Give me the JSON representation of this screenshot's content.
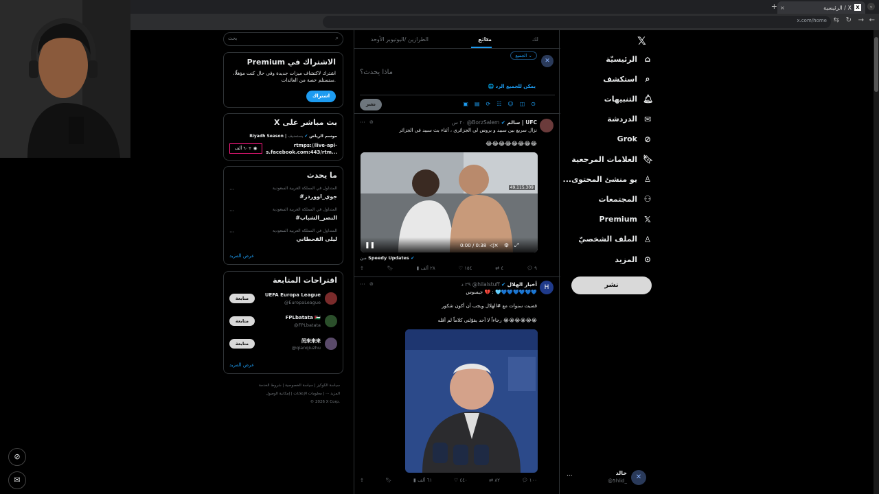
{
  "browser": {
    "tab_title": "الرئيسية / X",
    "url": "x.com/home",
    "new_tab": "+",
    "close": "×"
  },
  "nav": {
    "items": [
      {
        "label": "الرئيسيّة",
        "icon": "home-icon"
      },
      {
        "label": "استكشف",
        "icon": "search-icon"
      },
      {
        "label": "التنبيهات",
        "icon": "bell-icon"
      },
      {
        "label": "الدردشة",
        "icon": "mail-icon"
      },
      {
        "label": "Grok",
        "icon": "grok-icon"
      },
      {
        "label": "العلامات المرجعية",
        "icon": "bookmark-icon"
      },
      {
        "label": "...يو منشئ المحتوى",
        "icon": "creator-icon"
      },
      {
        "label": "المجتمعات",
        "icon": "communities-icon"
      },
      {
        "label": "Premium",
        "icon": "x-logo-icon"
      },
      {
        "label": "الملف الشخصيّ",
        "icon": "profile-icon"
      },
      {
        "label": "المزيد",
        "icon": "more-circle-icon"
      }
    ],
    "post_button": "نشر",
    "user_name": "خالد",
    "user_handle": "@5hlid_"
  },
  "timeline": {
    "tabs": [
      "لك",
      "متابَع",
      "الطرازين /اليوتيوبر الأوحد"
    ],
    "audience": "الجميع",
    "compose_placeholder": "ماذا يحدث؟",
    "reply_setting": "يمكن للجميع الرد",
    "post_button": "نشر",
    "tweets": [
      {
        "name": "سالم | UFC",
        "handle": "@BorzSalem",
        "time": "٢٠ س",
        "text": "نزال سريع بين سبيد و بروس لي الجزائري ، أثناء بث سبيد في الجزائر",
        "emoji": "😂😂😂😂😂😂😂😂",
        "video_time": "0:00 / 0:38",
        "video_views": "49,115,309",
        "source": "Speedy Updates",
        "source_prefix": "من",
        "replies": "٩",
        "reposts": "٤",
        "likes": "١٥٤",
        "views": "٢٨ ألف"
      },
      {
        "name": "أخبار الهلال",
        "handle": "@hilalstuff",
        "time": "٢٩ د",
        "line1": "جيسوس 💔 : 🩵💙💙💙💙💙💙",
        "line2": "قضيت سنوات مع #الهلال ويجب أن أكون شكور",
        "line3": "رجاءاً لا أحد يقوّلني كلاماً لم أقله 😭😭😭😭😭😭",
        "replies": "١٠٠",
        "reposts": "٨٢",
        "likes": "٤٤٠",
        "views": "٦١ ألف"
      }
    ]
  },
  "right": {
    "search_placeholder": "بحث",
    "premium": {
      "title": "Premium الاشتراك في",
      "body": "اشترك لاكتشاف ميزات جديدة وفي حال كنت مؤهلًا، ستستلم حصة من العائدات.",
      "button": "اشتراك"
    },
    "live": {
      "title": "X بث مباشر على",
      "host": "Riyadh Season | موسم الرياض",
      "tag": "يستضيف",
      "link": "rtmps://live-api-s.facebook.com:443/rtm...",
      "count": "٦٠ ألف+"
    },
    "trends": {
      "title": "ما يحدث",
      "items": [
        {
          "context": "المتداول في المملكة العربية السعودية",
          "name": "#جوي_اووردز"
        },
        {
          "context": "المتداول في المملكة العربية السعودية",
          "name": "#النصر_الشباب"
        },
        {
          "context": "المتداول في المملكة العربية السعودية",
          "name": "ليلى القحطاني"
        }
      ],
      "show_more": "عرض المزيد"
    },
    "follow": {
      "title": "اقتراحات المتابعة",
      "items": [
        {
          "name": "UEFA Europa League",
          "handle": "@EuropaLeague",
          "button": "متابعة"
        },
        {
          "name": "FPLbatata 🇵🇸",
          "handle": "@FPLbatata",
          "button": "متابعة"
        },
        {
          "name": "闰来来来",
          "handle": "@qianqiuzhu",
          "button": "متابعة"
        }
      ],
      "show_more": "عرض المزيد"
    },
    "footer": {
      "l1a": "شروط الخدمة",
      "l1b": "سياسة الخصوصية",
      "l1c": "سياسة الكوكيز",
      "l2a": "إمكانية الوصول",
      "l2b": "معلومات الإعلانات",
      "l2c": "المزيد ···",
      "copy": "© 2026 X Corp."
    }
  },
  "side_icons": [
    "grok-icon",
    "mail-icon"
  ]
}
